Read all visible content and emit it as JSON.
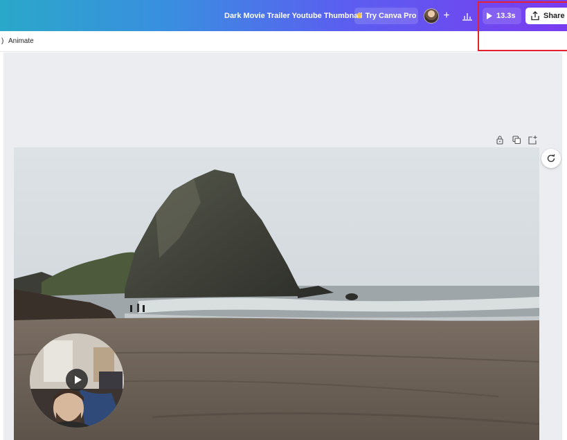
{
  "header": {
    "document_title": "Dark Movie Trailer Youtube Thumbnail",
    "try_pro_label": "Try Canva Pro",
    "play_duration": "13.3s",
    "share_label": "Share",
    "add_member_symbol": "+"
  },
  "toolbar": {
    "edge_glyph": ")",
    "animate_label": "Animate"
  },
  "icons": {
    "crown": "crown-icon",
    "insights": "bar-chart-icon",
    "play": "play-icon",
    "share": "share-upload-icon",
    "lock": "lock-icon",
    "duplicate": "duplicate-icon",
    "add_page": "add-page-icon",
    "regenerate": "regenerate-icon"
  },
  "colors": {
    "highlight": "#e8212e",
    "crown": "#ffc233"
  }
}
